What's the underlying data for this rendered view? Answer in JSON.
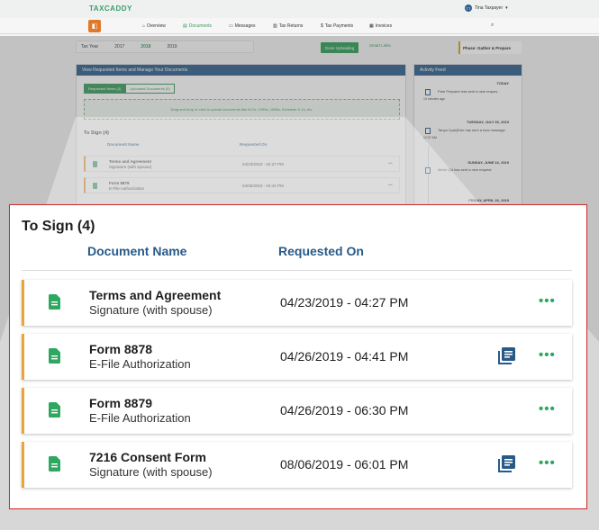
{
  "app": {
    "logo": "TAXCADDY",
    "user_initials": "TT",
    "user_name": "Tina Taxpayer",
    "nav": [
      {
        "label": "Overview"
      },
      {
        "label": "Documents"
      },
      {
        "label": "Messages"
      },
      {
        "label": "Tax Returns"
      },
      {
        "label": "Tax Payments"
      },
      {
        "label": "Invoices"
      }
    ],
    "tax_year_label": "Tax Year",
    "years": [
      "2017",
      "2018",
      "2019"
    ],
    "done_uploading": "Done Uploading",
    "smart_links": "Smart Links",
    "phase": "Phase: Gather & Prepare"
  },
  "panel": {
    "title": "View Requested Items and Manage Your Documents",
    "tab_requested": "Requested Items (3)",
    "tab_uploaded": "Uploaded Documents (0)",
    "drop_text": "Drag and drop or click to upload documents like W-2s, 1099s, 1098s, Schedule K-1s, etc."
  },
  "feed": {
    "title": "Activity Feed",
    "entries": [
      {
        "day": "TODAY",
        "text": "Pam Preparer has sent a new reques...",
        "time": "10 minutes ago"
      },
      {
        "day": "TUESDAY, JULY 30, 2019",
        "text": "Tanya CpaQKen has sent a new message.",
        "time": "12:37 AM"
      },
      {
        "day": "SUNDAY, JUNE 16, 2019",
        "text": "Alerie QA has sent a new request.",
        "time": ""
      },
      {
        "day": "FRIDAY, APRIL 26, 2019",
        "text": "",
        "time": ""
      }
    ]
  },
  "to_sign": {
    "title": "To Sign (4)",
    "col_document": "Document Name",
    "col_requested": "Requested On",
    "rows": [
      {
        "name": "Terms and Agreement",
        "subtitle": "Signature (with spouse)",
        "requested": "04/23/2019 - 04:27 PM",
        "has_review": false
      },
      {
        "name": "Form 8878",
        "subtitle": "E-File Authorization",
        "requested": "04/26/2019 - 04:41 PM",
        "has_review": true
      },
      {
        "name": "Form 8879",
        "subtitle": "E-File Authorization",
        "requested": "04/26/2019 - 06:30 PM",
        "has_review": false
      },
      {
        "name": "7216 Consent Form",
        "subtitle": "Signature (with spouse)",
        "requested": "08/06/2019 - 06:01 PM",
        "has_review": true
      }
    ],
    "mini_rows": [
      {
        "name": "Terms and Agreement",
        "subtitle": "Signature (with spouse)",
        "requested": "04/23/2019 - 04:27 PM"
      },
      {
        "name": "Form 8878",
        "subtitle": "E-File Authorization",
        "requested": "04/26/2019 - 04:41 PM"
      }
    ]
  },
  "colors": {
    "accent_green": "#2ea860",
    "header_blue": "#285a88",
    "row_accent_orange": "#eba33e",
    "highlight_red": "#d12b2b"
  }
}
